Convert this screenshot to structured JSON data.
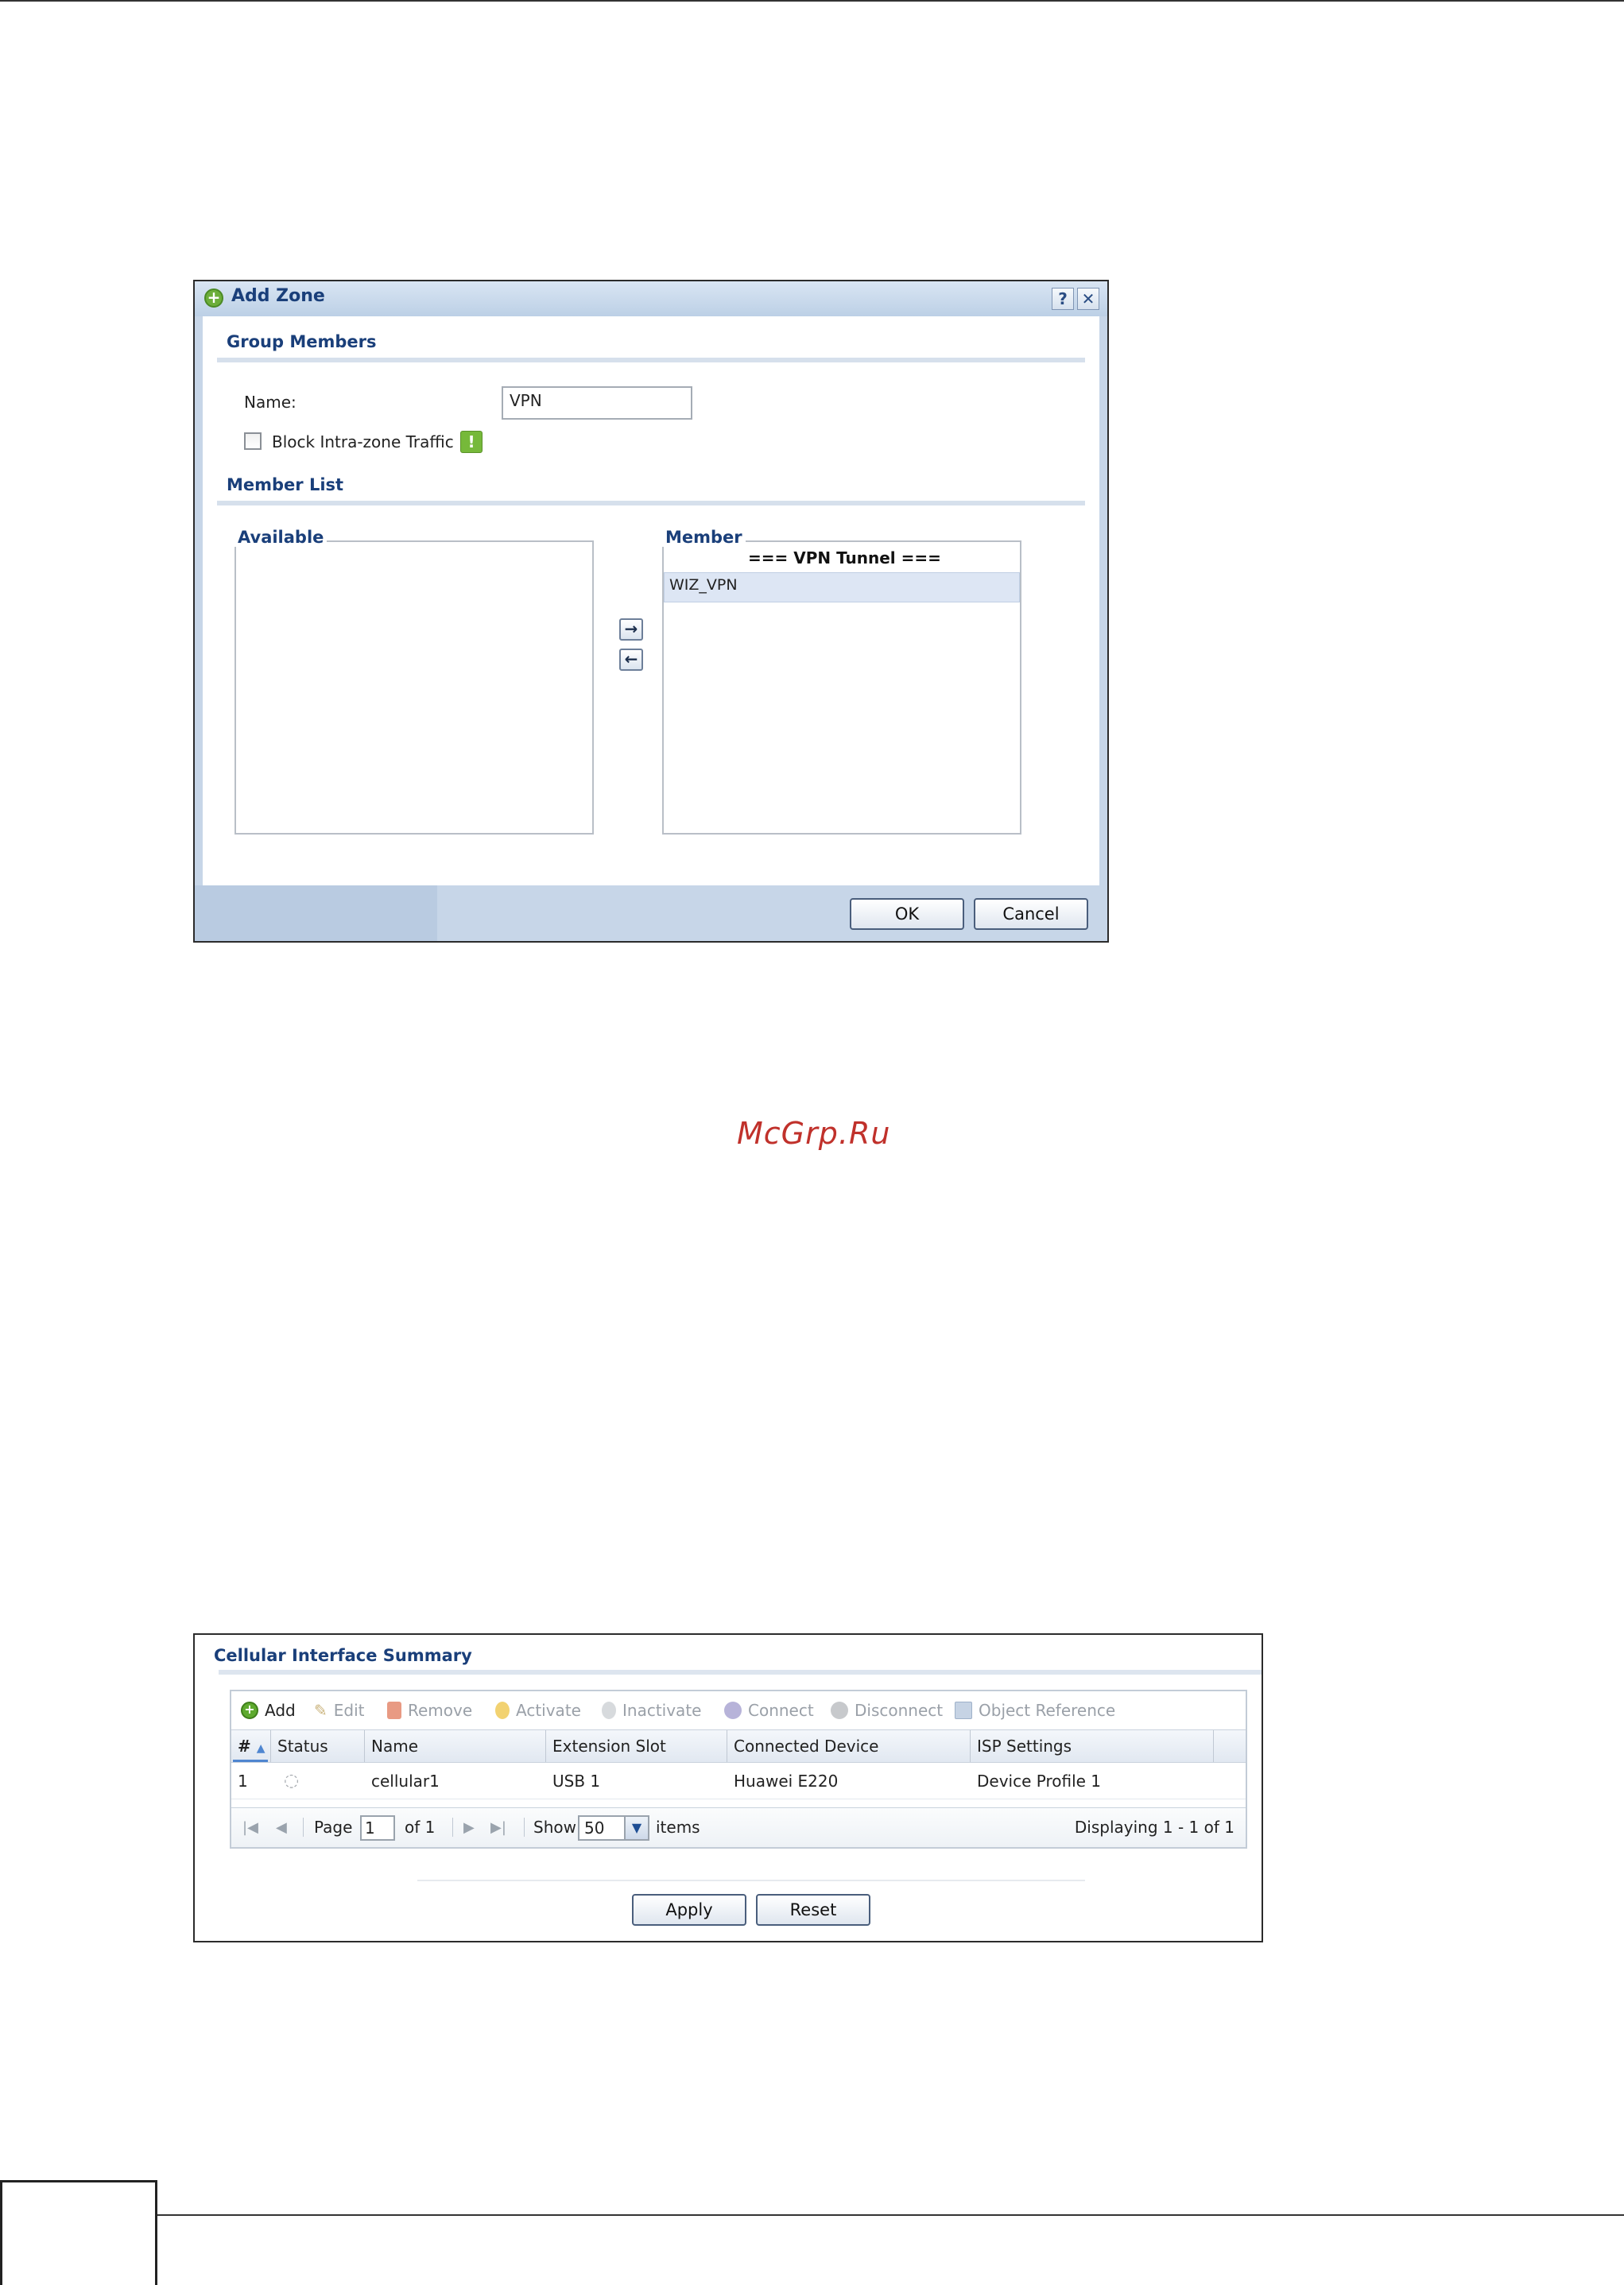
{
  "add_zone_dialog": {
    "title": "Add Zone",
    "help_icon": "question-icon",
    "close_icon": "close-icon",
    "group_members_title": "Group Members",
    "name_label": "Name:",
    "name_value": "VPN",
    "block_label": "Block Intra-zone Traffic",
    "block_checked": false,
    "member_list_title": "Member List",
    "available_legend": "Available",
    "member_legend": "Member",
    "member_group": "=== VPN Tunnel ===",
    "members": [
      "WIZ_VPN"
    ],
    "move_right": "→",
    "move_left": "←",
    "ok_label": "OK",
    "cancel_label": "Cancel"
  },
  "watermark": "McGrp.Ru",
  "cellular_summary": {
    "title": "Cellular Interface Summary",
    "toolbar": [
      {
        "label": "Add",
        "icon": "add-icon",
        "enabled": true
      },
      {
        "label": "Edit",
        "icon": "edit-icon",
        "enabled": false
      },
      {
        "label": "Remove",
        "icon": "remove-icon",
        "enabled": false
      },
      {
        "label": "Activate",
        "icon": "activate-bulb-icon",
        "enabled": false
      },
      {
        "label": "Inactivate",
        "icon": "inactivate-bulb-icon",
        "enabled": false
      },
      {
        "label": "Connect",
        "icon": "connect-icon",
        "enabled": false
      },
      {
        "label": "Disconnect",
        "icon": "disconnect-icon",
        "enabled": false
      },
      {
        "label": "Object Reference",
        "icon": "object-reference-icon",
        "enabled": false
      }
    ],
    "columns": [
      "#",
      "Status",
      "Name",
      "Extension Slot",
      "Connected Device",
      "ISP Settings"
    ],
    "rows": [
      {
        "num": "1",
        "status_icon": "inactive-bulb-icon",
        "name": "cellular1",
        "slot": "USB 1",
        "device": "Huawei E220",
        "isp": "Device Profile 1"
      }
    ],
    "pager": {
      "page_label": "Page",
      "page_value": "1",
      "of_label": "of 1",
      "show_label": "Show",
      "show_value": "50",
      "items_label": "items",
      "displaying": "Displaying 1 - 1 of 1"
    },
    "apply_label": "Apply",
    "reset_label": "Reset"
  }
}
